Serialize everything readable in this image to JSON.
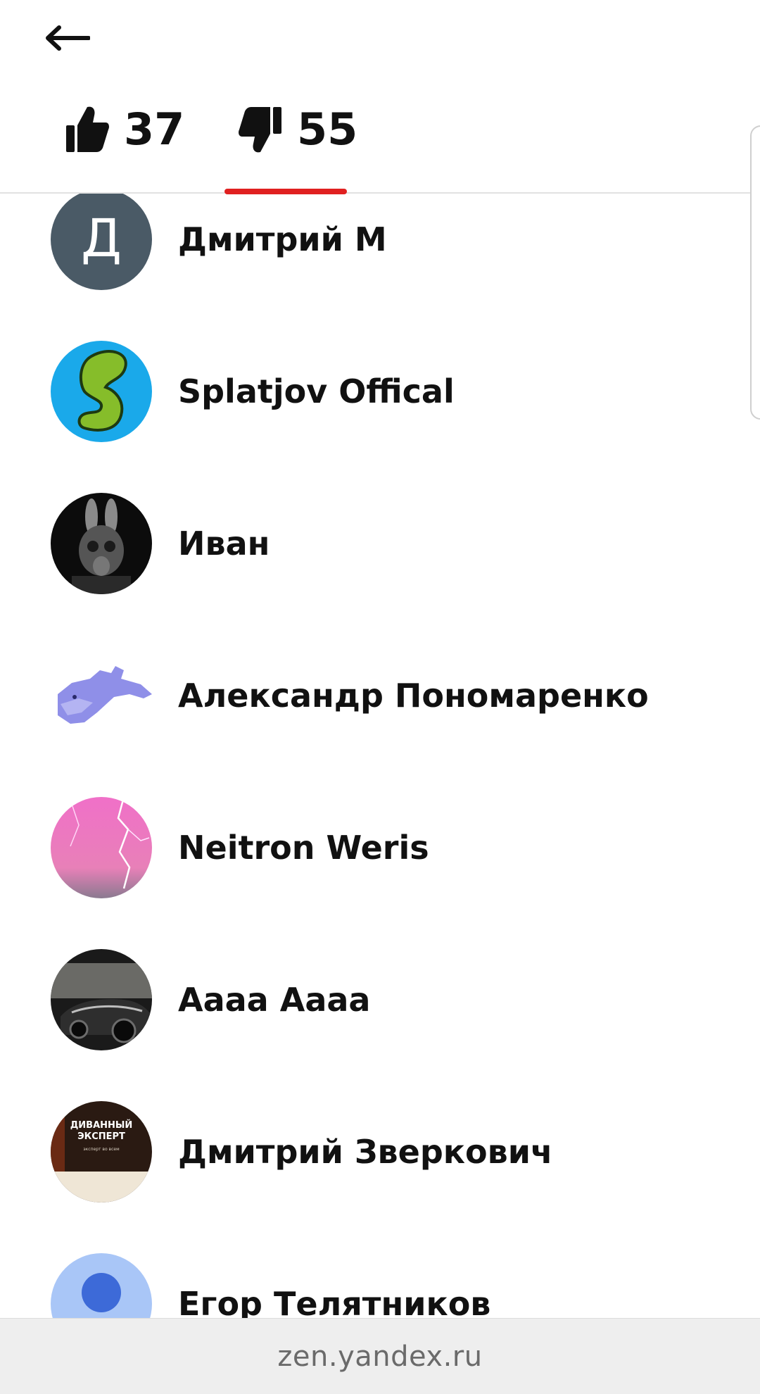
{
  "header": {
    "back_icon": "arrow-left-icon",
    "tabs": [
      {
        "icon": "thumbs-up-icon",
        "count": "37",
        "selected": false
      },
      {
        "icon": "thumbs-down-icon",
        "count": "55",
        "selected": true
      }
    ],
    "accent_color": "#e02020"
  },
  "users": [
    {
      "name": "Дмитрий М",
      "avatar": "letter-avatar",
      "avatar_letter": "Д"
    },
    {
      "name": "Splatjov Offical",
      "avatar": "splatjov-logo-avatar"
    },
    {
      "name": "Иван",
      "avatar": "gasmask-rabbit-avatar"
    },
    {
      "name": "Александр Пономаренко",
      "avatar": "pixel-fish-avatar"
    },
    {
      "name": "Neitron Weris",
      "avatar": "lightning-avatar"
    },
    {
      "name": "Аааа Аааа",
      "avatar": "car-avatar"
    },
    {
      "name": "Дмитрий Зверкович",
      "avatar": "sofa-expert-avatar",
      "avatar_text_1": "ДИВАННЫЙ",
      "avatar_text_2": "ЭКСПЕРТ",
      "avatar_text_3": "эксперт во всем"
    },
    {
      "name": "Егор Телятников",
      "avatar": "default-avatar"
    }
  ],
  "browser": {
    "url": "zen.yandex.ru"
  }
}
